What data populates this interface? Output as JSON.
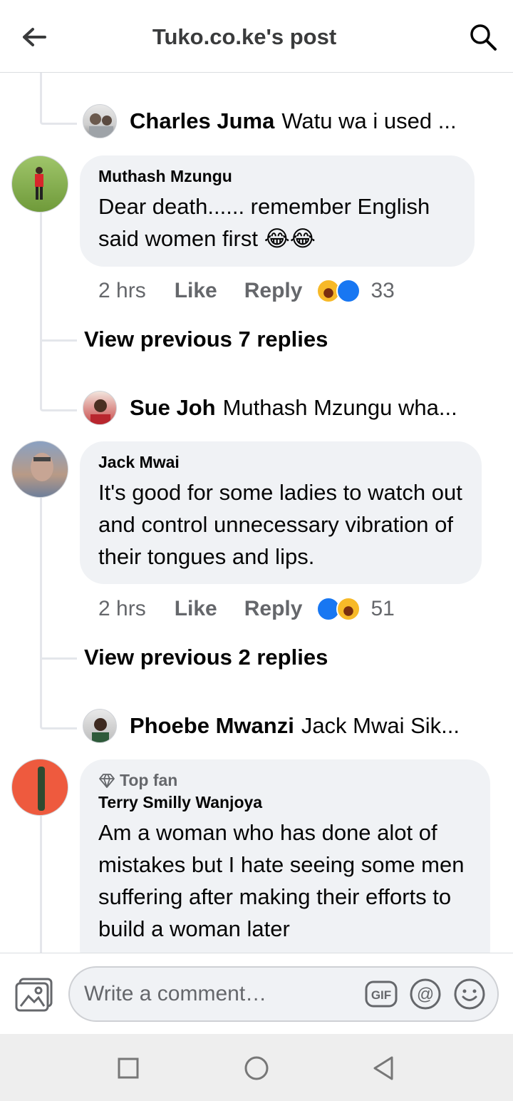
{
  "header": {
    "title": "Tuko.co.ke's post",
    "back_icon": "arrow-left-icon",
    "search_icon": "search-icon"
  },
  "threads": [
    {
      "reply_preview": {
        "name": "Charles Juma",
        "text": "Watu wa i used ..."
      }
    },
    {
      "comment": {
        "author": "Muthash Mzungu",
        "body": "Dear death...... remember English said women first 😂😂",
        "time": "2 hrs",
        "like": "Like",
        "reply": "Reply",
        "reaction_count": "33",
        "reactions": [
          "haha",
          "like"
        ]
      },
      "view_previous": "View previous 7 replies",
      "reply_preview": {
        "name": "Sue Joh",
        "text": "Muthash Mzungu wha..."
      }
    },
    {
      "comment": {
        "author": "Jack Mwai",
        "body": "It's good for some ladies to watch out and control unnecessary vibration of their tongues and lips.",
        "time": "2 hrs",
        "like": "Like",
        "reply": "Reply",
        "reaction_count": "51",
        "reactions": [
          "like",
          "haha"
        ]
      },
      "view_previous": "View previous 2 replies",
      "reply_preview": {
        "name": "Phoebe Mwanzi",
        "text": "Jack Mwai Sik..."
      }
    },
    {
      "comment": {
        "badge": "Top fan",
        "author": "Terry Smilly Wanjoya",
        "body": "Am a woman who has done alot of mistakes but I hate seeing some men suffering after making their efforts to build a woman later"
      }
    }
  ],
  "composer": {
    "placeholder": "Write a comment…",
    "icons": [
      "photo-icon",
      "gif-icon",
      "mention-icon",
      "emoji-icon"
    ]
  },
  "navbar": {
    "icons": [
      "recents-square-icon",
      "home-circle-icon",
      "back-triangle-icon"
    ]
  },
  "colors": {
    "bubble": "#f0f2f5",
    "secondary_text": "#65676b",
    "like_blue": "#1877f2",
    "haha_yellow": "#f7b928",
    "thread_line": "#e4e6eb"
  }
}
